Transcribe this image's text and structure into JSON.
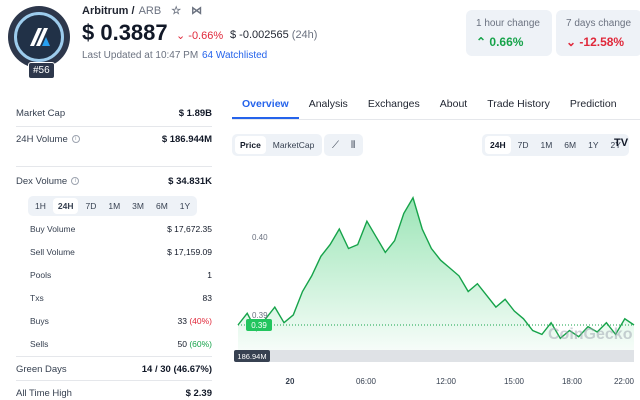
{
  "header": {
    "coin_name": "Arbitrum /",
    "symbol": "ARB",
    "price": "$ 0.3887",
    "pct_change": "-0.66%",
    "abs_change": "$ -0.002565",
    "abs_period": "(24h)",
    "last_updated": "Last Updated at 10:47 PM",
    "watchlist": "64 Watchlisted",
    "rank": "#56",
    "star_icon": "star-icon",
    "share_icon": "share-icon"
  },
  "change_cards": [
    {
      "label": "1 hour change",
      "value": "0.66%",
      "direction": "up"
    },
    {
      "label": "7 days change",
      "value": "-12.58%",
      "direction": "down"
    }
  ],
  "stats": {
    "market_cap_label": "Market Cap",
    "market_cap_value": "$ 1.89B",
    "volume_label": "24H Volume",
    "volume_value": "$ 186.944M",
    "dex_label": "Dex Volume",
    "dex_value": "$ 34.831K",
    "dex_tabs": [
      "1H",
      "24H",
      "7D",
      "1M",
      "3M",
      "6M",
      "1Y"
    ],
    "dex_tab_active": "24H",
    "sub": [
      {
        "k": "Buy Volume",
        "v": "$ 17,672.35"
      },
      {
        "k": "Sell Volume",
        "v": "$ 17,159.09"
      },
      {
        "k": "Pools",
        "v": "1"
      },
      {
        "k": "Txs",
        "v": "83"
      }
    ],
    "buys_label": "Buys",
    "buys_value": "33",
    "buys_pct": "(40%)",
    "sells_label": "Sells",
    "sells_value": "50",
    "sells_pct": "(60%)",
    "green_days_label": "Green Days",
    "green_days_value": "14 / 30 (46.67%)",
    "ath_label": "All Time High",
    "ath_value": "$ 2.39"
  },
  "tabs": [
    "Overview",
    "Analysis",
    "Exchanges",
    "About",
    "Trade History",
    "Prediction"
  ],
  "tab_active": "Overview",
  "chart_controls": {
    "type_buttons": [
      "Price",
      "MarketCap"
    ],
    "type_active": "Price",
    "range_buttons": [
      "24H",
      "7D",
      "1M",
      "6M",
      "1Y",
      "2Y"
    ],
    "range_active": "24H",
    "line_icon": "line-chart-icon",
    "candle_icon": "candlestick-icon",
    "tv_icon": "tradingview-icon",
    "tv_label": "TV"
  },
  "chart_data": {
    "type": "area",
    "x": [
      "20",
      "06:00",
      "12:00",
      "15:00",
      "18:00",
      "22:00"
    ],
    "ytick_labels": [
      "0.40",
      "0.39"
    ],
    "current_price_tag": "0.39",
    "volume_tag": "186.94M",
    "watermark": "CoinGecko",
    "series": [
      {
        "values": [
          0.3887,
          0.3902,
          0.388,
          0.3895,
          0.391,
          0.389,
          0.39,
          0.393,
          0.395,
          0.3975,
          0.399,
          0.401,
          0.3985,
          0.399,
          0.402,
          0.4,
          0.398,
          0.3995,
          0.403,
          0.405,
          0.401,
          0.3985,
          0.397,
          0.396,
          0.395,
          0.393,
          0.394,
          0.3925,
          0.391,
          0.392,
          0.3905,
          0.3895,
          0.388,
          0.3875,
          0.389,
          0.387,
          0.388,
          0.3872,
          0.3885,
          0.3878,
          0.389,
          0.3875,
          0.3895,
          0.3887
        ],
        "color": "#16a34a"
      }
    ]
  }
}
